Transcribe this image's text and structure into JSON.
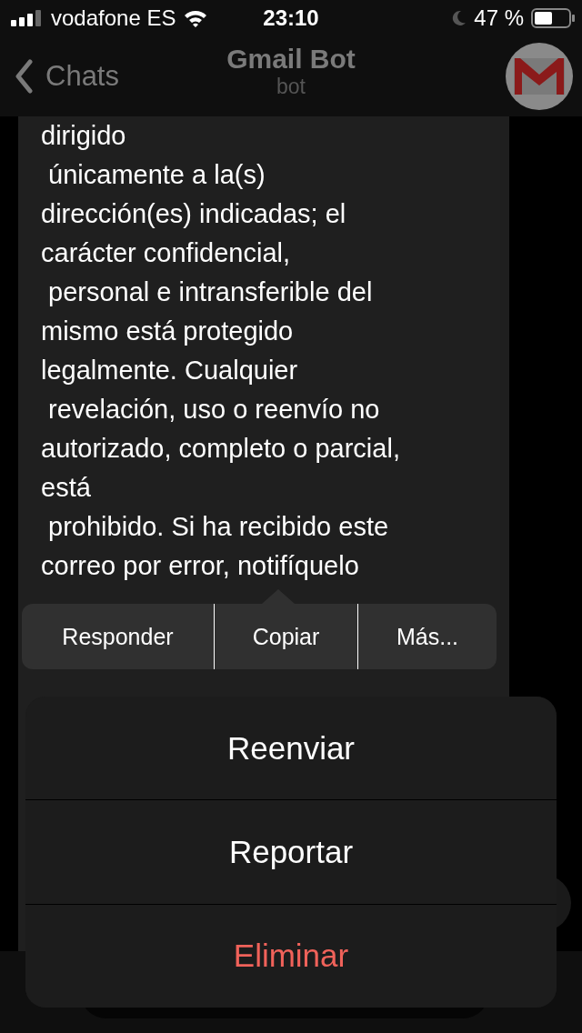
{
  "status_bar": {
    "carrier": "vodafone ES",
    "time": "23:10",
    "battery": "47 %"
  },
  "nav": {
    "back": "Chats",
    "title": "Gmail Bot",
    "subtitle": "bot"
  },
  "message": {
    "lines": [
      "dirigido",
      " únicamente a la(s)",
      "dirección(es) indicadas; el",
      "carácter confidencial,",
      " personal e intransferible del",
      "mismo está protegido",
      "legalmente. Cualquier",
      " revelación, uso o reenvío no",
      "autorizado, completo o parcial,",
      "está",
      " prohibido. Si ha recibido este",
      "correo por error, notifíquelo"
    ]
  },
  "edit_menu": [
    "Responder",
    "Copiar",
    "Más..."
  ],
  "action_sheet": [
    {
      "label": "Reenviar",
      "kind": "default"
    },
    {
      "label": "Reportar",
      "kind": "default"
    },
    {
      "label": "Eliminar",
      "kind": "destructive"
    }
  ]
}
